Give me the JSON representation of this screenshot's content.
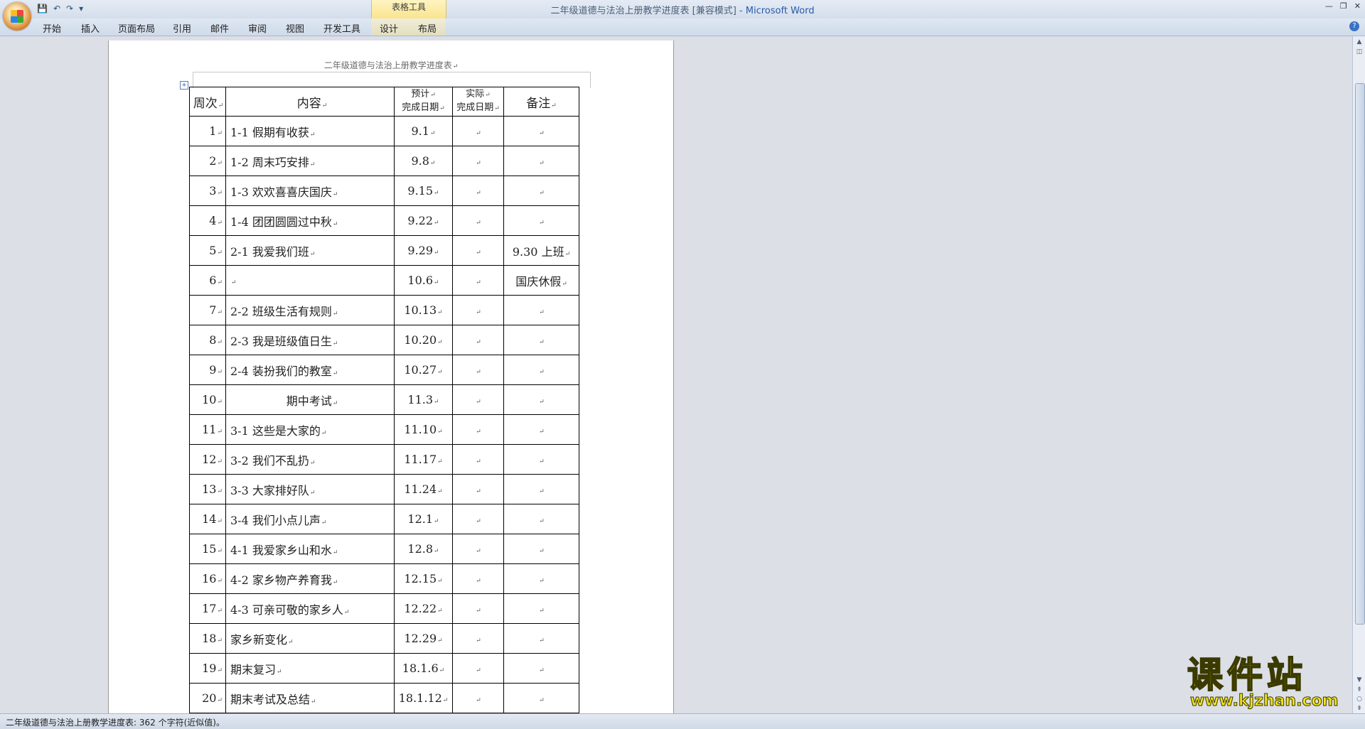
{
  "window": {
    "doc_name": "二年级道德与法治上册教学进度表 [兼容模式]",
    "separator": " - ",
    "app_name": "Microsoft Word",
    "contextual_group": "表格工具"
  },
  "ribbon_tabs": [
    "开始",
    "插入",
    "页面布局",
    "引用",
    "邮件",
    "审阅",
    "视图",
    "开发工具",
    "设计",
    "布局"
  ],
  "document": {
    "title": "二年级道德与法治上册教学进度表",
    "headers": {
      "week": "周次",
      "content": "内容",
      "planned_line1": "预计",
      "planned_line2": "完成日期",
      "actual_line1": "实际",
      "actual_line2": "完成日期",
      "notes": "备注"
    },
    "rows": [
      {
        "week": "1",
        "content": "1-1 假期有收获",
        "planned": "9.1",
        "actual": "",
        "notes": ""
      },
      {
        "week": "2",
        "content": "1-2 周末巧安排",
        "planned": "9.8",
        "actual": "",
        "notes": ""
      },
      {
        "week": "3",
        "content": "1-3 欢欢喜喜庆国庆",
        "planned": "9.15",
        "actual": "",
        "notes": ""
      },
      {
        "week": "4",
        "content": "1-4 团团圆圆过中秋",
        "planned": "9.22",
        "actual": "",
        "notes": ""
      },
      {
        "week": "5",
        "content": "2-1 我爱我们班",
        "planned": "9.29",
        "actual": "",
        "notes": "9.30 上班"
      },
      {
        "week": "6",
        "content": "",
        "planned": "10.6",
        "actual": "",
        "notes": "国庆休假"
      },
      {
        "week": "7",
        "content": "2-2 班级生活有规则",
        "planned": "10.13",
        "actual": "",
        "notes": ""
      },
      {
        "week": "8",
        "content": "2-3 我是班级值日生",
        "planned": "10.20",
        "actual": "",
        "notes": ""
      },
      {
        "week": "9",
        "content": "2-4 装扮我们的教室",
        "planned": "10.27",
        "actual": "",
        "notes": ""
      },
      {
        "week": "10",
        "content": "期中考试",
        "planned": "11.3",
        "actual": "",
        "notes": ""
      },
      {
        "week": "11",
        "content": "3-1 这些是大家的",
        "planned": "11.10",
        "actual": "",
        "notes": ""
      },
      {
        "week": "12",
        "content": "3-2 我们不乱扔",
        "planned": "11.17",
        "actual": "",
        "notes": ""
      },
      {
        "week": "13",
        "content": "3-3 大家排好队",
        "planned": "11.24",
        "actual": "",
        "notes": ""
      },
      {
        "week": "14",
        "content": "3-4 我们小点儿声",
        "planned": "12.1",
        "actual": "",
        "notes": ""
      },
      {
        "week": "15",
        "content": "4-1 我爱家乡山和水",
        "planned": "12.8",
        "actual": "",
        "notes": ""
      },
      {
        "week": "16",
        "content": "4-2 家乡物产养育我",
        "planned": "12.15",
        "actual": "",
        "notes": ""
      },
      {
        "week": "17",
        "content": "4-3 可亲可敬的家乡人",
        "planned": "12.22",
        "actual": "",
        "notes": ""
      },
      {
        "week": "18",
        "content": "家乡新变化",
        "planned": "12.29",
        "actual": "",
        "notes": ""
      },
      {
        "week": "19",
        "content": "期末复习",
        "planned": "18.1.6",
        "actual": "",
        "notes": ""
      },
      {
        "week": "20",
        "content": "期末考试及总结",
        "planned": "18.1.12",
        "actual": "",
        "notes": ""
      }
    ]
  },
  "status_bar": {
    "text": "二年级道德与法治上册教学进度表: 362 个字符(近似值)。"
  },
  "watermark": {
    "brand": "课件站",
    "url": "www.kjzhan.com"
  }
}
